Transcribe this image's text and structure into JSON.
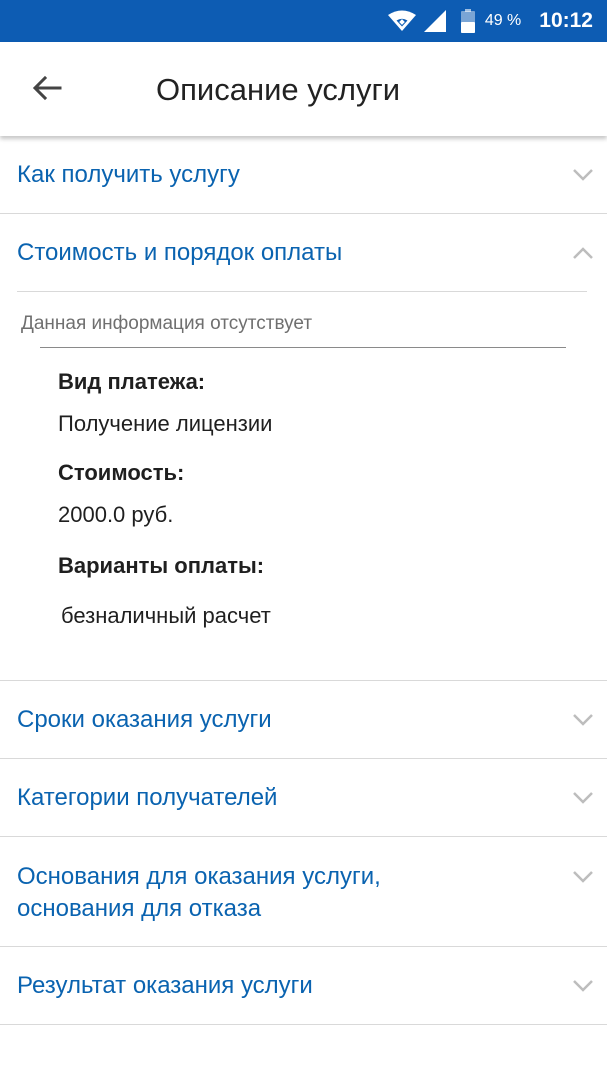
{
  "status_bar": {
    "battery_percent": "49 %",
    "time": "10:12",
    "battery_level": 0.49,
    "icons": [
      "wifi-icon",
      "signal-icon",
      "battery-icon"
    ]
  },
  "app_bar": {
    "title": "Описание услуги",
    "back_icon": "arrow-left-icon"
  },
  "colors": {
    "accent": "#0d5cb3",
    "link": "#0a63b0",
    "divider": "#d9d9d9"
  },
  "sections": [
    {
      "title": "Как получить услугу",
      "expanded": false
    },
    {
      "title": "Стоимость и порядок оплаты",
      "expanded": true,
      "no_info_text": "Данная информация отсутствует",
      "payment_type_label": "Вид платежа:",
      "payment_type_value": "Получение лицензии",
      "cost_label": "Стоимость:",
      "cost_value": "2000.0 руб.",
      "payment_options_label": "Варианты оплаты:",
      "payment_options_value": "безналичный расчет"
    },
    {
      "title": "Сроки оказания услуги",
      "expanded": false
    },
    {
      "title": "Категории получателей",
      "expanded": false
    },
    {
      "title_line1": "Основания для оказания услуги,",
      "title_line2": "основания для отказа",
      "expanded": false
    },
    {
      "title": "Результат оказания услуги",
      "expanded": false
    }
  ]
}
